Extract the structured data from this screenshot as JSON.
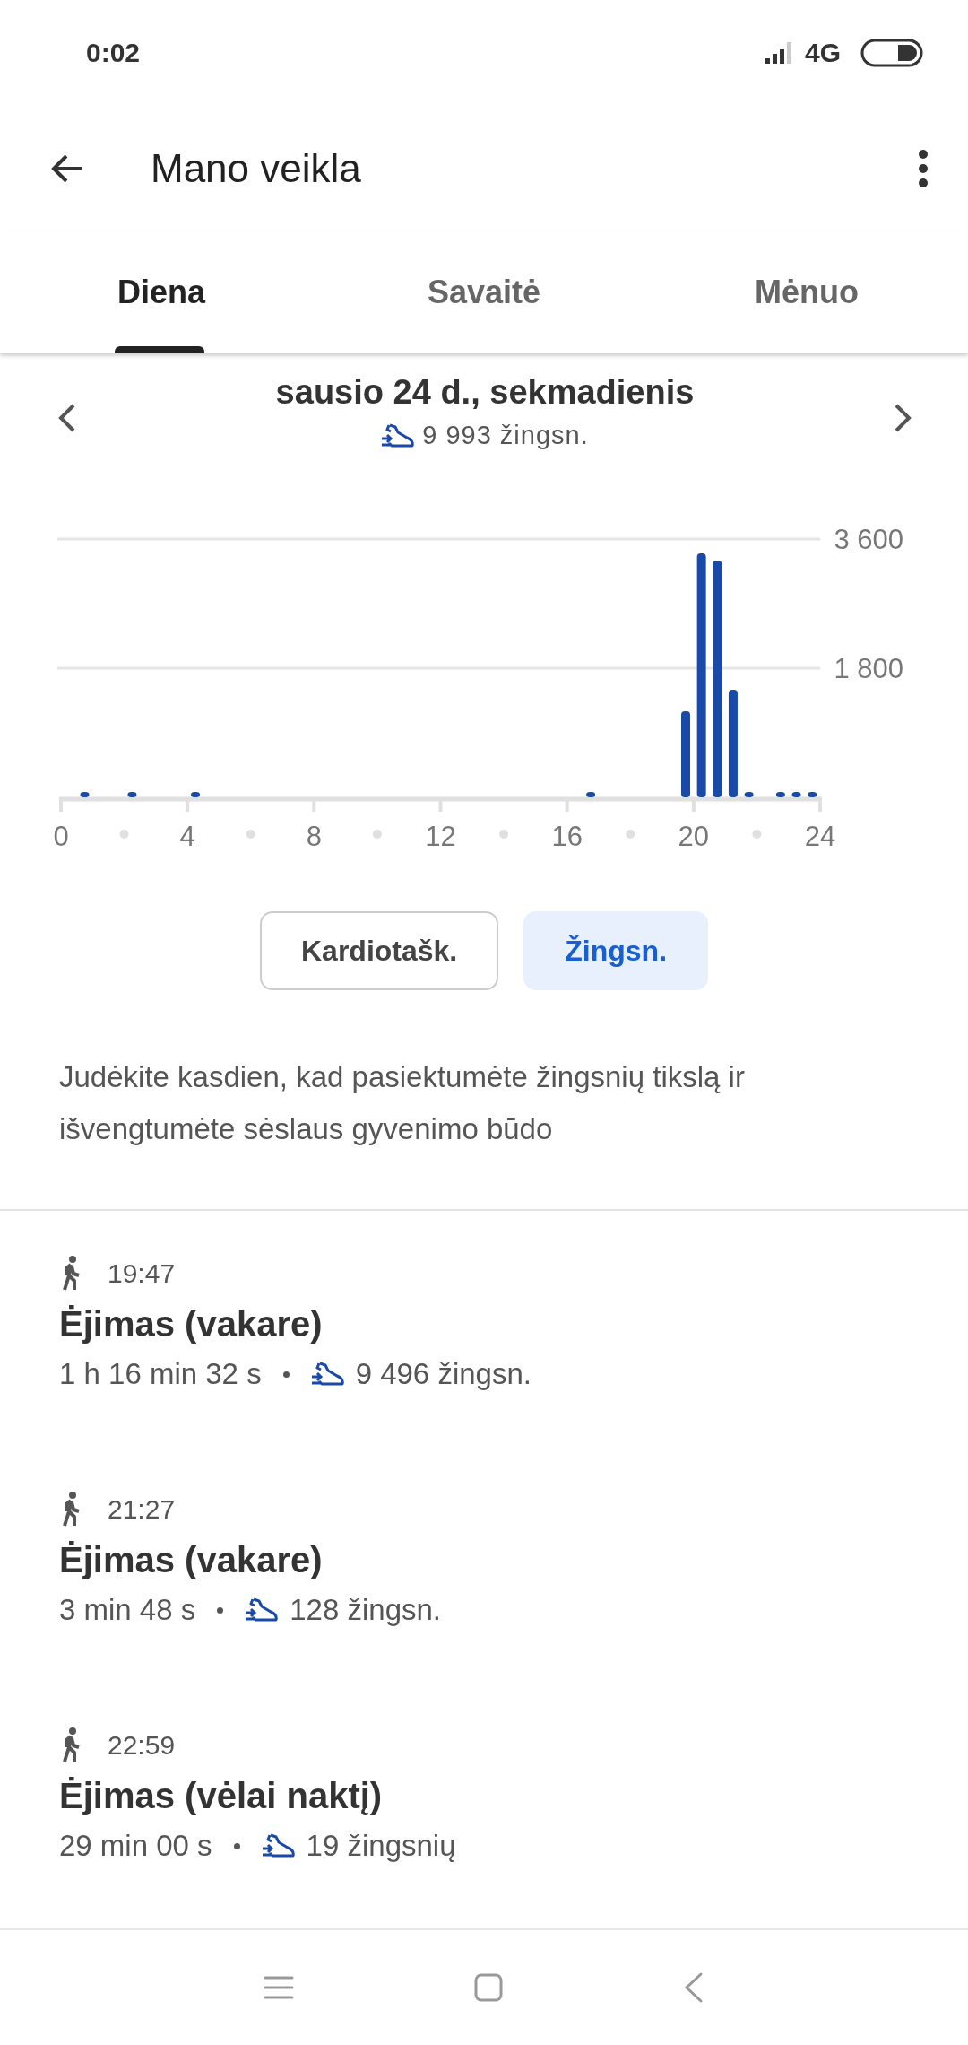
{
  "status_bar": {
    "time": "0:02",
    "network": "4G"
  },
  "toolbar": {
    "title": "Mano veikla"
  },
  "tabs": [
    {
      "label": "Diena",
      "selected": true
    },
    {
      "label": "Savaitė",
      "selected": false
    },
    {
      "label": "Mėnuo",
      "selected": false
    }
  ],
  "date_nav": {
    "date": "sausio 24 d., sekmadienis",
    "steps": "9 993 žingsn."
  },
  "chart_data": {
    "type": "bar",
    "x": [
      0.75,
      2.25,
      4.25,
      16.75,
      19.75,
      20.25,
      20.75,
      21.25,
      21.75,
      22.75,
      23.25,
      23.75
    ],
    "values": [
      75,
      75,
      75,
      75,
      1200,
      3400,
      3300,
      1500,
      75,
      75,
      75,
      75
    ],
    "xlim": [
      0,
      24
    ],
    "ylim": [
      0,
      3600
    ],
    "xticks": [
      0,
      4,
      8,
      12,
      16,
      20,
      24
    ],
    "yticks": [
      {
        "value": 1800,
        "label": "1 800"
      },
      {
        "value": 3600,
        "label": "3 600"
      }
    ]
  },
  "metric_buttons": [
    {
      "label": "Kardiotašk.",
      "selected": false
    },
    {
      "label": "Žingsn.",
      "selected": true
    }
  ],
  "message": "Judėkite kasdien, kad pasiektumėte žingsnių tikslą ir išvengtumėte sėslaus gyvenimo būdo",
  "activities": [
    {
      "time": "19:47",
      "title": "Ėjimas (vakare)",
      "duration": "1 h 16 min 32 s",
      "steps": "9 496 žingsn."
    },
    {
      "time": "21:27",
      "title": "Ėjimas (vakare)",
      "duration": "3 min 48 s",
      "steps": "128 žingsn."
    },
    {
      "time": "22:59",
      "title": "Ėjimas (vėlai naktį)",
      "duration": "29 min 00 s",
      "steps": "19 žingsnių"
    }
  ]
}
